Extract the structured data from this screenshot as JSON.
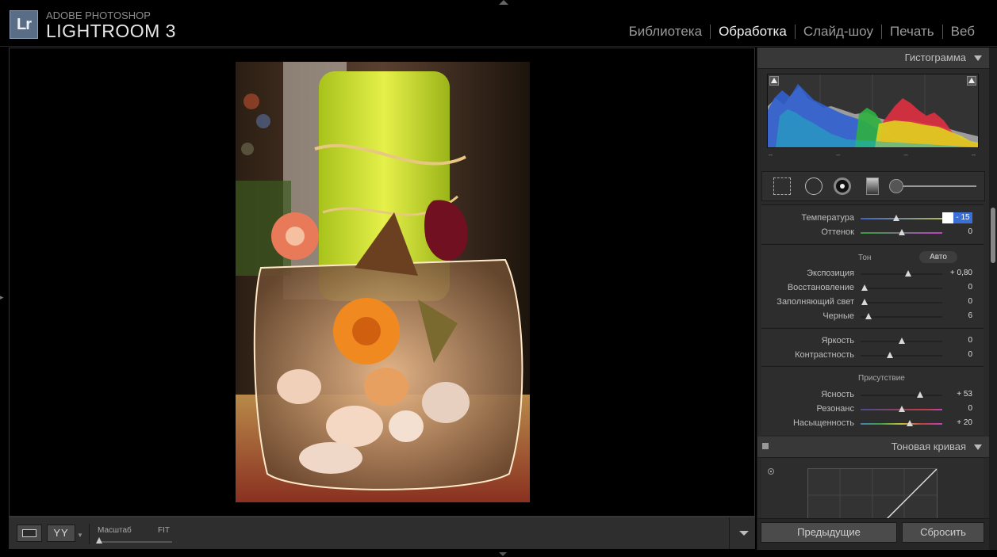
{
  "app": {
    "logo": "Lr",
    "brand_top": "ADOBE PHOTOSHOP",
    "brand_main": "LIGHTROOM 3"
  },
  "modules": [
    {
      "label": "Библиотека",
      "active": false
    },
    {
      "label": "Обработка",
      "active": true
    },
    {
      "label": "Слайд-шоу",
      "active": false
    },
    {
      "label": "Печать",
      "active": false
    },
    {
      "label": "Веб",
      "active": false
    }
  ],
  "toolbar": {
    "yy_label": "YY",
    "zoom_label": "Масштаб",
    "zoom_value": "FIT"
  },
  "histogram": {
    "title": "Гистограмма",
    "info": [
      "–",
      "–",
      "–",
      "–"
    ]
  },
  "basic": {
    "temperature": {
      "label": "Температура",
      "value": "- 15",
      "position": 0.44
    },
    "tint": {
      "label": "Оттенок",
      "value": "0",
      "position": 0.5
    },
    "tone_head": "Тон",
    "auto_label": "Авто",
    "exposure": {
      "label": "Экспозиция",
      "value": "+ 0,80",
      "position": 0.58
    },
    "recovery": {
      "label": "Восстановление",
      "value": "0",
      "position": 0.05
    },
    "fill_light": {
      "label": "Заполняющий свет",
      "value": "0",
      "position": 0.05
    },
    "blacks": {
      "label": "Черные",
      "value": "6",
      "position": 0.1
    },
    "brightness": {
      "label": "Яркость",
      "value": "0",
      "position": 0.5
    },
    "contrast": {
      "label": "Контрастность",
      "value": "0",
      "position": 0.36
    },
    "presence_head": "Присутствие",
    "clarity": {
      "label": "Ясность",
      "value": "+ 53",
      "position": 0.73
    },
    "vibrance": {
      "label": "Резонанс",
      "value": "0",
      "position": 0.5
    },
    "saturation": {
      "label": "Насыщенность",
      "value": "+ 20",
      "position": 0.6
    }
  },
  "tone_curve": {
    "title": "Тоновая кривая"
  },
  "buttons": {
    "previous": "Предыдущие",
    "reset": "Сбросить"
  },
  "colors": {
    "background": "#000000",
    "panel": "#2a2a2a",
    "active_module": "#f2f2f2",
    "selection": "#3a6fd8"
  }
}
